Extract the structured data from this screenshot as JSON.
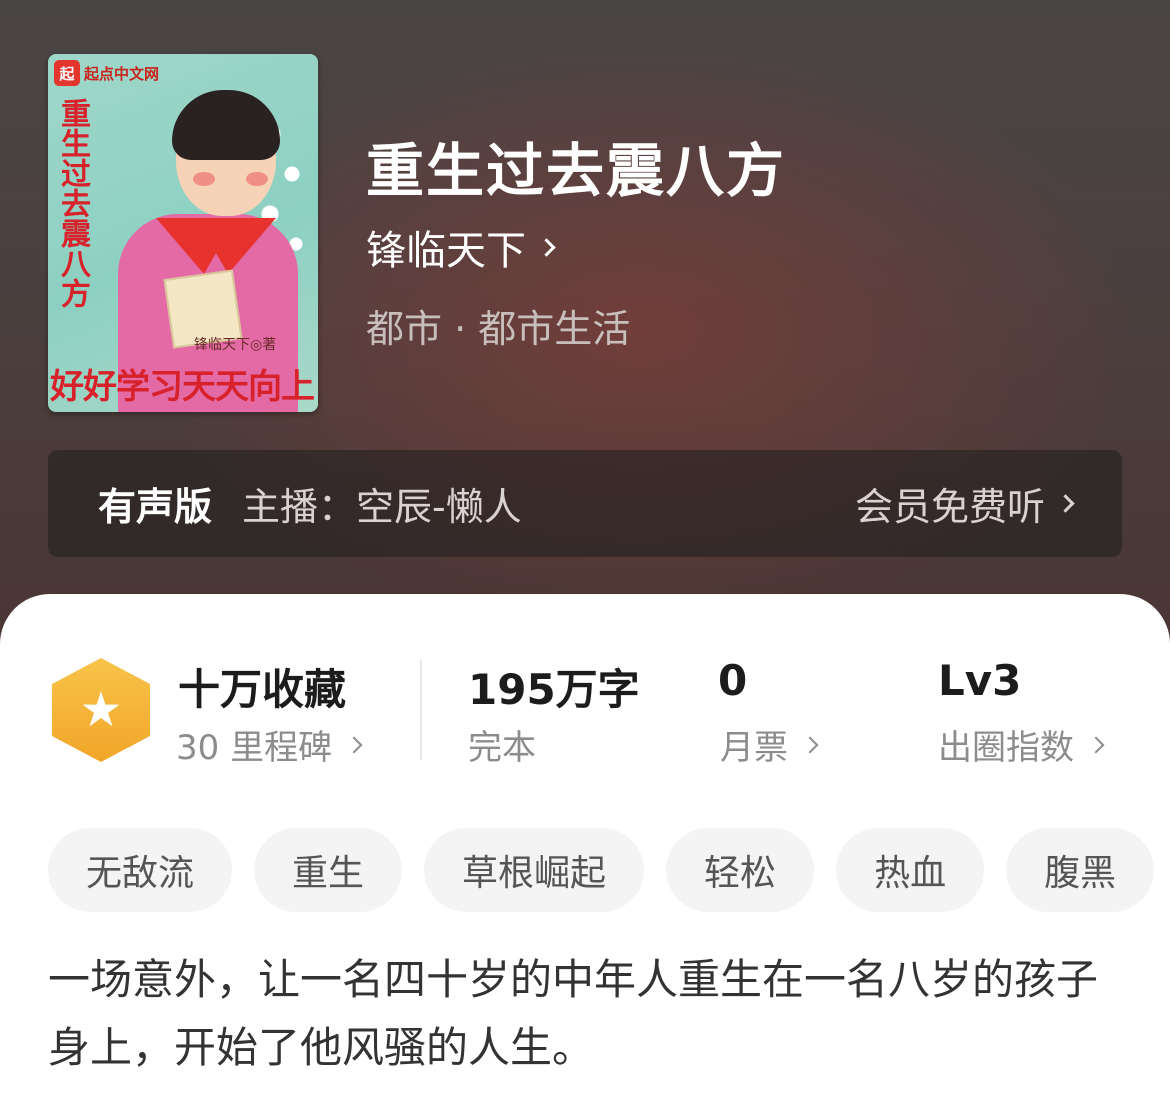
{
  "book": {
    "title": "重生过去震八方",
    "author": "锋临天下",
    "category": "都市 · 都市生活",
    "cover": {
      "publisher_logo_char": "起",
      "publisher": "起点中文网",
      "vertical_title": "重生过去震八方",
      "author_mark": "锋临天下◎著",
      "slogan": "好好学习天天向上"
    }
  },
  "audio": {
    "label": "有声版",
    "narrator": "主播：空辰-懒人",
    "action": "会员免费听"
  },
  "stats": {
    "favorites": {
      "value": "十万收藏",
      "sub": "30 里程碑"
    },
    "words": {
      "value": "195万字",
      "sub": "完本"
    },
    "monthly_votes": {
      "value": "0",
      "sub": "月票"
    },
    "influence": {
      "value": "Lv3",
      "sub": "出圈指数"
    }
  },
  "tags": [
    "无敌流",
    "重生",
    "草根崛起",
    "轻松",
    "热血",
    "腹黑"
  ],
  "synopsis": "一场意外，让一名四十岁的中年人重生在一名八岁的孩子身上，开始了他风骚的人生。",
  "colors": {
    "badge": "#f1a628",
    "cover_red": "#d8222b",
    "hero_bg": "#4a3d3c"
  },
  "icons": {
    "badge": "star-icon",
    "chevron": "chevron-right-icon"
  }
}
